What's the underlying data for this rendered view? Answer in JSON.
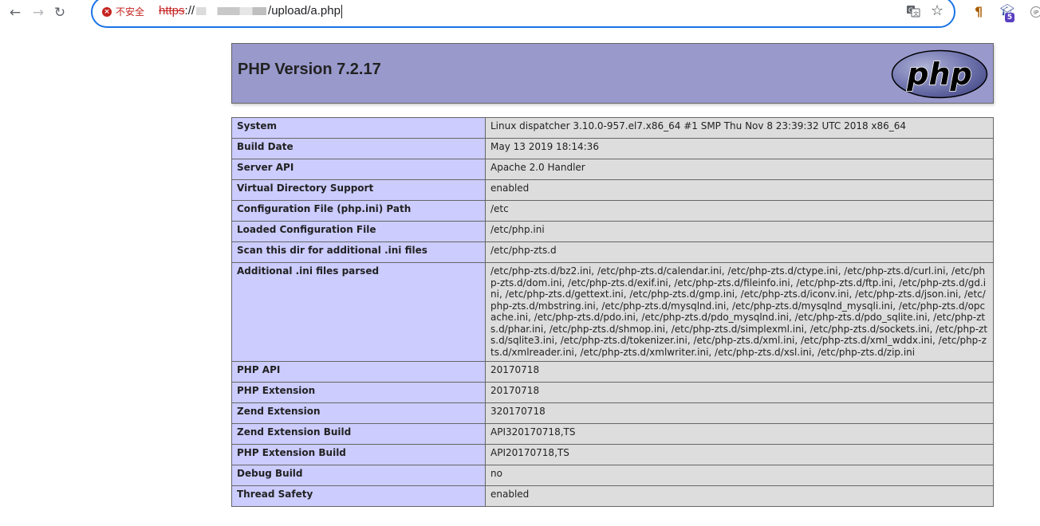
{
  "browser": {
    "back_icon": "arrow-left-icon",
    "forward_icon": "arrow-right-icon",
    "reload_icon": "reload-icon",
    "security_label": "不安全",
    "url_scheme": "https",
    "url_sep": "://",
    "url_path": "/upload/a.php",
    "translate_icon": "translate-icon",
    "bookmark_icon": "star-icon",
    "extension_badge": "5",
    "extension_ip_label": "IP"
  },
  "header": {
    "title": "PHP Version 7.2.17",
    "logo_text": "php"
  },
  "rows": [
    {
      "key": "System",
      "value": "Linux dispatcher 3.10.0-957.el7.x86_64 #1 SMP Thu Nov 8 23:39:32 UTC 2018 x86_64"
    },
    {
      "key": "Build Date",
      "value": "May 13 2019 18:14:36"
    },
    {
      "key": "Server API",
      "value": "Apache 2.0 Handler"
    },
    {
      "key": "Virtual Directory Support",
      "value": "enabled"
    },
    {
      "key": "Configuration File (php.ini) Path",
      "value": "/etc"
    },
    {
      "key": "Loaded Configuration File",
      "value": "/etc/php.ini"
    },
    {
      "key": "Scan this dir for additional .ini files",
      "value": "/etc/php-zts.d"
    },
    {
      "key": "Additional .ini files parsed",
      "value": "/etc/php-zts.d/bz2.ini, /etc/php-zts.d/calendar.ini, /etc/php-zts.d/ctype.ini, /etc/php-zts.d/curl.ini, /etc/php-zts.d/dom.ini, /etc/php-zts.d/exif.ini, /etc/php-zts.d/fileinfo.ini, /etc/php-zts.d/ftp.ini, /etc/php-zts.d/gd.ini, /etc/php-zts.d/gettext.ini, /etc/php-zts.d/gmp.ini, /etc/php-zts.d/iconv.ini, /etc/php-zts.d/json.ini, /etc/php-zts.d/mbstring.ini, /etc/php-zts.d/mysqlnd.ini, /etc/php-zts.d/mysqlnd_mysqli.ini, /etc/php-zts.d/opcache.ini, /etc/php-zts.d/pdo.ini, /etc/php-zts.d/pdo_mysqlnd.ini, /etc/php-zts.d/pdo_sqlite.ini, /etc/php-zts.d/phar.ini, /etc/php-zts.d/shmop.ini, /etc/php-zts.d/simplexml.ini, /etc/php-zts.d/sockets.ini, /etc/php-zts.d/sqlite3.ini, /etc/php-zts.d/tokenizer.ini, /etc/php-zts.d/xml.ini, /etc/php-zts.d/xml_wddx.ini, /etc/php-zts.d/xmlreader.ini, /etc/php-zts.d/xmlwriter.ini, /etc/php-zts.d/xsl.ini, /etc/php-zts.d/zip.ini"
    },
    {
      "key": "PHP API",
      "value": "20170718"
    },
    {
      "key": "PHP Extension",
      "value": "20170718"
    },
    {
      "key": "Zend Extension",
      "value": "320170718"
    },
    {
      "key": "Zend Extension Build",
      "value": "API320170718,TS"
    },
    {
      "key": "PHP Extension Build",
      "value": "API20170718,TS"
    },
    {
      "key": "Debug Build",
      "value": "no"
    },
    {
      "key": "Thread Safety",
      "value": "enabled"
    }
  ],
  "colors": {
    "header_bg": "#9999cc",
    "key_cell_bg": "#ccccff",
    "value_cell_bg": "#dddddd",
    "omnibox_border": "#1a73e8",
    "insecure_red": "#c5221f"
  }
}
